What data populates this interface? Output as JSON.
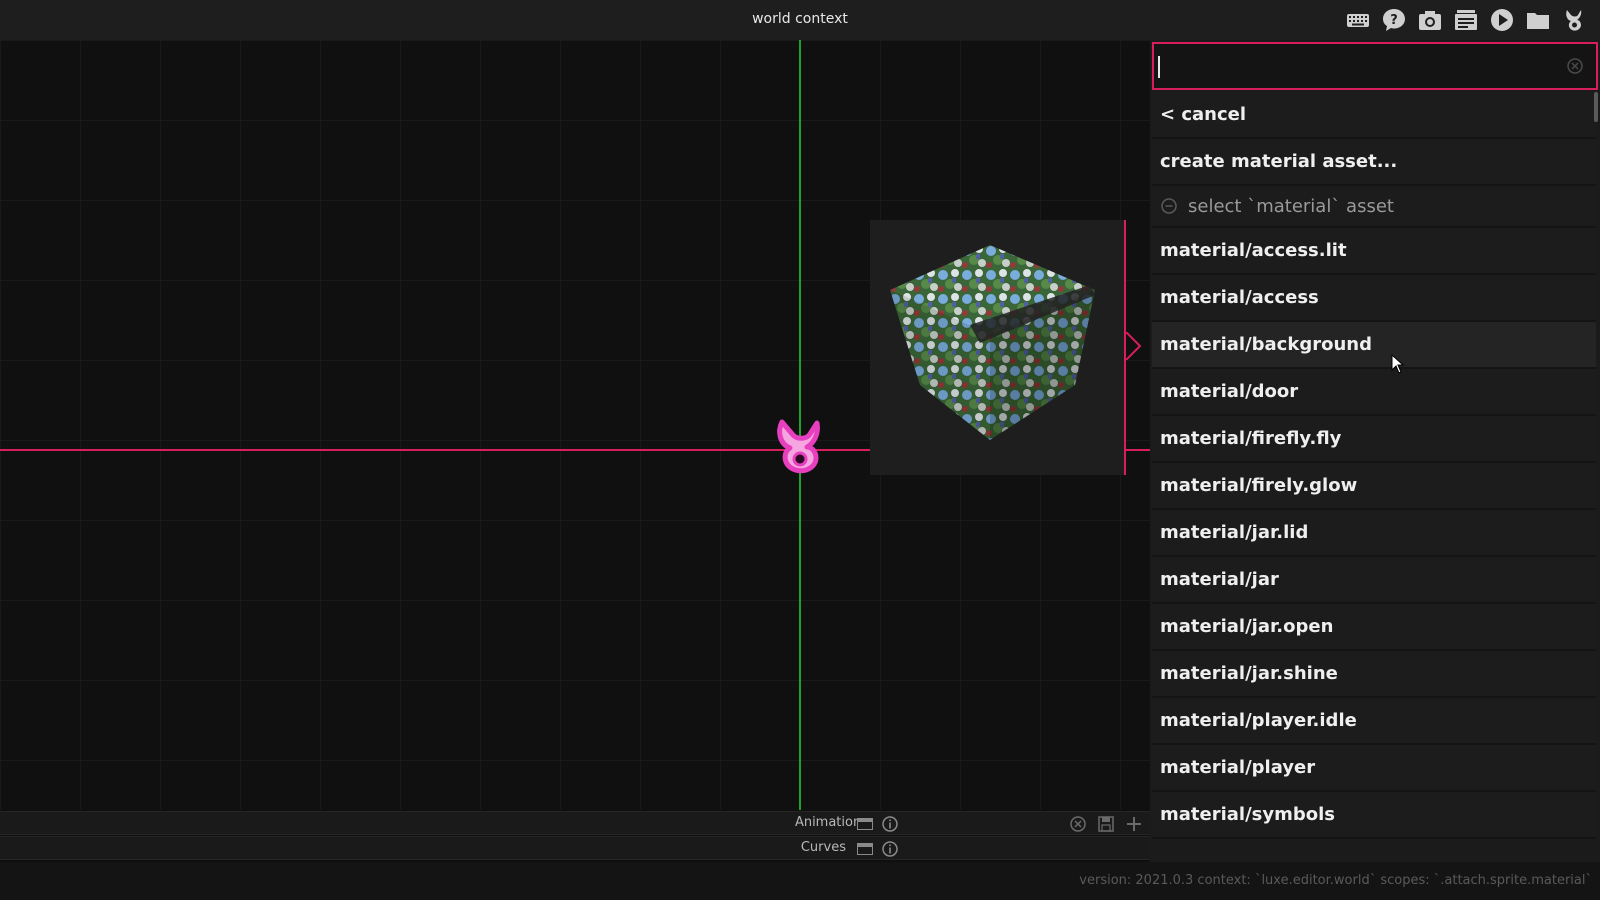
{
  "window": {
    "title": "world context"
  },
  "toolbar": {
    "buttons": [
      {
        "name": "keyboard-icon"
      },
      {
        "name": "help-icon"
      },
      {
        "name": "camera-icon"
      },
      {
        "name": "cards-icon"
      },
      {
        "name": "play-icon"
      },
      {
        "name": "folder-icon"
      },
      {
        "name": "luxe-logo-icon"
      }
    ]
  },
  "viewport": {
    "axis_colors": {
      "x": "#d81e5b",
      "y": "#1fa12a"
    },
    "origin_icon": "luxe-logo-icon"
  },
  "panels": {
    "animations": {
      "label": "Animations"
    },
    "curves": {
      "label": "Curves"
    }
  },
  "search": {
    "value": "",
    "placeholder": ""
  },
  "list": {
    "cancel": "< cancel",
    "create": "create material asset...",
    "hint": "select `material` asset",
    "items": [
      "material/access.lit",
      "material/access",
      "material/background",
      "material/door",
      "material/firefly.fly",
      "material/firely.glow",
      "material/jar.lid",
      "material/jar",
      "material/jar.open",
      "material/jar.shine",
      "material/player.idle",
      "material/player",
      "material/symbols"
    ],
    "hovered_index": 2
  },
  "status": {
    "version": "version: 2021.0.3 context: `luxe.editor.world` scopes: `.attach.sprite.material`"
  },
  "colors": {
    "accent": "#d81e5b",
    "green": "#1fa12a",
    "panel": "#1b1b1b"
  }
}
